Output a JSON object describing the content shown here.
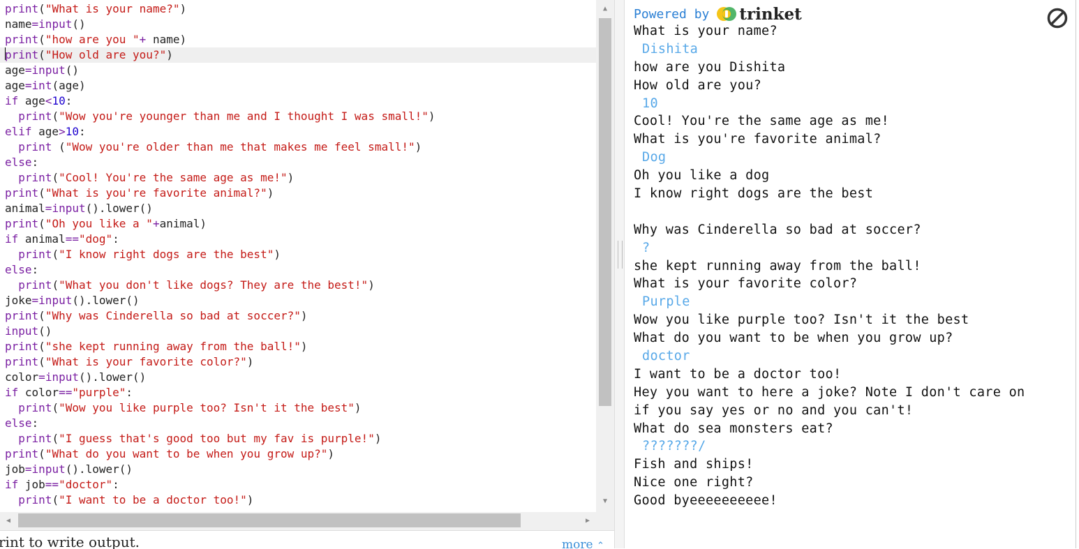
{
  "editor": {
    "active_line": 3,
    "lines": [
      [
        [
          "kw",
          "print"
        ],
        [
          "id",
          "("
        ],
        [
          "str",
          "\"What is your name?\""
        ],
        [
          "id",
          ")"
        ]
      ],
      [
        [
          "id",
          "name"
        ],
        [
          "op",
          "="
        ],
        [
          "kw",
          "input"
        ],
        [
          "id",
          "()"
        ]
      ],
      [
        [
          "kw",
          "print"
        ],
        [
          "id",
          "("
        ],
        [
          "str",
          "\"how are you \""
        ],
        [
          "op",
          "+"
        ],
        [
          "id",
          " name)"
        ]
      ],
      [
        [
          "kw",
          "print"
        ],
        [
          "id",
          "("
        ],
        [
          "str",
          "\"How old are you?\""
        ],
        [
          "id",
          ")"
        ]
      ],
      [
        [
          "id",
          "age"
        ],
        [
          "op",
          "="
        ],
        [
          "kw",
          "input"
        ],
        [
          "id",
          "()"
        ]
      ],
      [
        [
          "id",
          "age"
        ],
        [
          "op",
          "="
        ],
        [
          "kw",
          "int"
        ],
        [
          "id",
          "(age)"
        ]
      ],
      [
        [
          "kw",
          "if"
        ],
        [
          "id",
          " age"
        ],
        [
          "op",
          "<"
        ],
        [
          "num",
          "10"
        ],
        [
          "id",
          ":"
        ]
      ],
      [
        [
          "id",
          "  "
        ],
        [
          "kw",
          "print"
        ],
        [
          "id",
          "("
        ],
        [
          "str",
          "\"Wow you're younger than me and I thought I was small!\""
        ],
        [
          "id",
          ")"
        ]
      ],
      [
        [
          "kw",
          "elif"
        ],
        [
          "id",
          " age"
        ],
        [
          "op",
          ">"
        ],
        [
          "num",
          "10"
        ],
        [
          "id",
          ":"
        ]
      ],
      [
        [
          "id",
          "  "
        ],
        [
          "kw",
          "print"
        ],
        [
          "id",
          " ("
        ],
        [
          "str",
          "\"Wow you're older than me that makes me feel small!\""
        ],
        [
          "id",
          ")"
        ]
      ],
      [
        [
          "kw",
          "else"
        ],
        [
          "id",
          ":"
        ]
      ],
      [
        [
          "id",
          "  "
        ],
        [
          "kw",
          "print"
        ],
        [
          "id",
          "("
        ],
        [
          "str",
          "\"Cool! You're the same age as me!\""
        ],
        [
          "id",
          ")"
        ]
      ],
      [
        [
          "kw",
          "print"
        ],
        [
          "id",
          "("
        ],
        [
          "str",
          "\"What is you're favorite animal?\""
        ],
        [
          "id",
          ")"
        ]
      ],
      [
        [
          "id",
          "animal"
        ],
        [
          "op",
          "="
        ],
        [
          "kw",
          "input"
        ],
        [
          "id",
          "().lower()"
        ]
      ],
      [
        [
          "kw",
          "print"
        ],
        [
          "id",
          "("
        ],
        [
          "str",
          "\"Oh you like a \""
        ],
        [
          "op",
          "+"
        ],
        [
          "id",
          "animal)"
        ]
      ],
      [
        [
          "kw",
          "if"
        ],
        [
          "id",
          " animal"
        ],
        [
          "op",
          "=="
        ],
        [
          "str",
          "\"dog\""
        ],
        [
          "id",
          ":"
        ]
      ],
      [
        [
          "id",
          "  "
        ],
        [
          "kw",
          "print"
        ],
        [
          "id",
          "("
        ],
        [
          "str",
          "\"I know right dogs are the best\""
        ],
        [
          "id",
          ")"
        ]
      ],
      [
        [
          "kw",
          "else"
        ],
        [
          "id",
          ":"
        ]
      ],
      [
        [
          "id",
          "  "
        ],
        [
          "kw",
          "print"
        ],
        [
          "id",
          "("
        ],
        [
          "str",
          "\"What you don't like dogs? They are the best!\""
        ],
        [
          "id",
          ")"
        ]
      ],
      [
        [
          "id",
          "joke"
        ],
        [
          "op",
          "="
        ],
        [
          "kw",
          "input"
        ],
        [
          "id",
          "().lower()"
        ]
      ],
      [
        [
          "kw",
          "print"
        ],
        [
          "id",
          "("
        ],
        [
          "str",
          "\"Why was Cinderella so bad at soccer?\""
        ],
        [
          "id",
          ")"
        ]
      ],
      [
        [
          "kw",
          "input"
        ],
        [
          "id",
          "()"
        ]
      ],
      [
        [
          "kw",
          "print"
        ],
        [
          "id",
          "("
        ],
        [
          "str",
          "\"she kept running away from the ball!\""
        ],
        [
          "id",
          ")"
        ]
      ],
      [
        [
          "kw",
          "print"
        ],
        [
          "id",
          "("
        ],
        [
          "str",
          "\"What is your favorite color?\""
        ],
        [
          "id",
          ")"
        ]
      ],
      [
        [
          "id",
          "color"
        ],
        [
          "op",
          "="
        ],
        [
          "kw",
          "input"
        ],
        [
          "id",
          "().lower()"
        ]
      ],
      [
        [
          "kw",
          "if"
        ],
        [
          "id",
          " color"
        ],
        [
          "op",
          "=="
        ],
        [
          "str",
          "\"purple\""
        ],
        [
          "id",
          ":"
        ]
      ],
      [
        [
          "id",
          "  "
        ],
        [
          "kw",
          "print"
        ],
        [
          "id",
          "("
        ],
        [
          "str",
          "\"Wow you like purple too? Isn't it the best\""
        ],
        [
          "id",
          ")"
        ]
      ],
      [
        [
          "kw",
          "else"
        ],
        [
          "id",
          ":"
        ]
      ],
      [
        [
          "id",
          "  "
        ],
        [
          "kw",
          "print"
        ],
        [
          "id",
          "("
        ],
        [
          "str",
          "\"I guess that's good too but my fav is purple!\""
        ],
        [
          "id",
          ")"
        ]
      ],
      [
        [
          "kw",
          "print"
        ],
        [
          "id",
          "("
        ],
        [
          "str",
          "\"What do you want to be when you grow up?\""
        ],
        [
          "id",
          ")"
        ]
      ],
      [
        [
          "id",
          "job"
        ],
        [
          "op",
          "="
        ],
        [
          "kw",
          "input"
        ],
        [
          "id",
          "().lower()"
        ]
      ],
      [
        [
          "kw",
          "if"
        ],
        [
          "id",
          " job"
        ],
        [
          "op",
          "=="
        ],
        [
          "str",
          "\"doctor\""
        ],
        [
          "id",
          ":"
        ]
      ],
      [
        [
          "id",
          "  "
        ],
        [
          "kw",
          "print"
        ],
        [
          "id",
          "("
        ],
        [
          "str",
          "\"I want to be a doctor too!\""
        ],
        [
          "id",
          ")"
        ]
      ]
    ]
  },
  "hint": {
    "text": "rint  to write output.",
    "more_label": "more",
    "more_icon": "chevron-double-up-icon"
  },
  "output": {
    "powered_by": "Powered by",
    "brand": "trinket",
    "stop_icon": "stop-icon",
    "lines": [
      {
        "t": "What is your name?",
        "input": false
      },
      {
        "t": "Dishita",
        "input": true
      },
      {
        "t": "how are you Dishita",
        "input": false
      },
      {
        "t": "How old are you?",
        "input": false
      },
      {
        "t": "10",
        "input": true
      },
      {
        "t": "Cool! You're the same age as me!",
        "input": false
      },
      {
        "t": "What is you're favorite animal?",
        "input": false
      },
      {
        "t": "Dog",
        "input": true
      },
      {
        "t": "Oh you like a dog",
        "input": false
      },
      {
        "t": "I know right dogs are the best",
        "input": false
      },
      {
        "t": "",
        "input": false
      },
      {
        "t": "Why was Cinderella so bad at soccer?",
        "input": false
      },
      {
        "t": "?",
        "input": true
      },
      {
        "t": "she kept running away from the ball!",
        "input": false
      },
      {
        "t": "What is your favorite color?",
        "input": false
      },
      {
        "t": "Purple",
        "input": true
      },
      {
        "t": "Wow you like purple too? Isn't it the best",
        "input": false
      },
      {
        "t": "What do you want to be when you grow up?",
        "input": false
      },
      {
        "t": "doctor",
        "input": true
      },
      {
        "t": "I want to be a doctor too!",
        "input": false
      },
      {
        "t": "Hey you want to here a joke? Note I don't care on",
        "input": false
      },
      {
        "t": "if you say yes or no and you can't!",
        "input": false
      },
      {
        "t": "What do sea monsters eat?",
        "input": false
      },
      {
        "t": "???????/",
        "input": true
      },
      {
        "t": "Fish and ships!",
        "input": false
      },
      {
        "t": "Nice one right?",
        "input": false
      },
      {
        "t": "Good byeeeeeeeeee!",
        "input": false
      }
    ]
  },
  "colors": {
    "keyword": "#7a1fa2",
    "string": "#c41a16",
    "number": "#1c00cf",
    "input_echo": "#57a8e8",
    "link": "#3a8fd8"
  }
}
